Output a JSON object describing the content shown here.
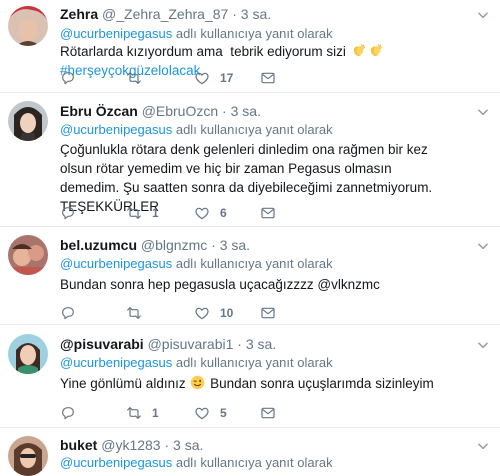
{
  "reply_prefix": "@ucurbenipegasus",
  "reply_suffix": "adlı kullanıcıya yanıt olarak",
  "dot": "·",
  "tweets": [
    {
      "name": "Zehra",
      "handle": "@_Zehra_Zehra_87",
      "time": "3 sa.",
      "text_before_emoji": "Rötarlarda kızıyordum ama  tebrik ediyorum sizi ",
      "emoji": "clapping-hands-emoji",
      "hashtag": "#herşeyçokgüzelolacak",
      "reply_count": "",
      "retweet_count": "",
      "like_count": "17"
    },
    {
      "name": "Ebru Özcan",
      "handle": "@EbruOzcn",
      "time": "3 sa.",
      "text": "Çoğunlukla rötara denk gelenleri dinledim ona rağmen bir kez olsun rötar yemedim ve hiç bir zaman Pegasus olmasın demedim. Şu saatten sonra da diyebileceğimi zannetmiyorum. TEŞEKKÜRLER",
      "reply_count": "",
      "retweet_count": "1",
      "like_count": "6"
    },
    {
      "name": "bel.uzumcu",
      "handle": "@blgnzmc",
      "time": "3 sa.",
      "text": "Bundan sonra hep pegasusla uçacağızzzz @vlknzmc",
      "reply_count": "",
      "retweet_count": "",
      "like_count": "10"
    },
    {
      "name": "@pisuvarabi",
      "handle": "@pisuvarabi1",
      "time": "3 sa.",
      "text_before_emoji": "Yine gönlümü aldınız ",
      "emoji": "winking-face-emoji",
      "text_after_emoji": " Bundan sonra uçuşlarımda sizinleyim",
      "reply_count": "",
      "retweet_count": "1",
      "like_count": "5"
    },
    {
      "name": "buket",
      "handle": "@yk1283",
      "time": "3 sa."
    }
  ],
  "colors": {
    "link": "#1b95e0",
    "secondary_text": "#657786",
    "divider": "#e6ecf0"
  }
}
